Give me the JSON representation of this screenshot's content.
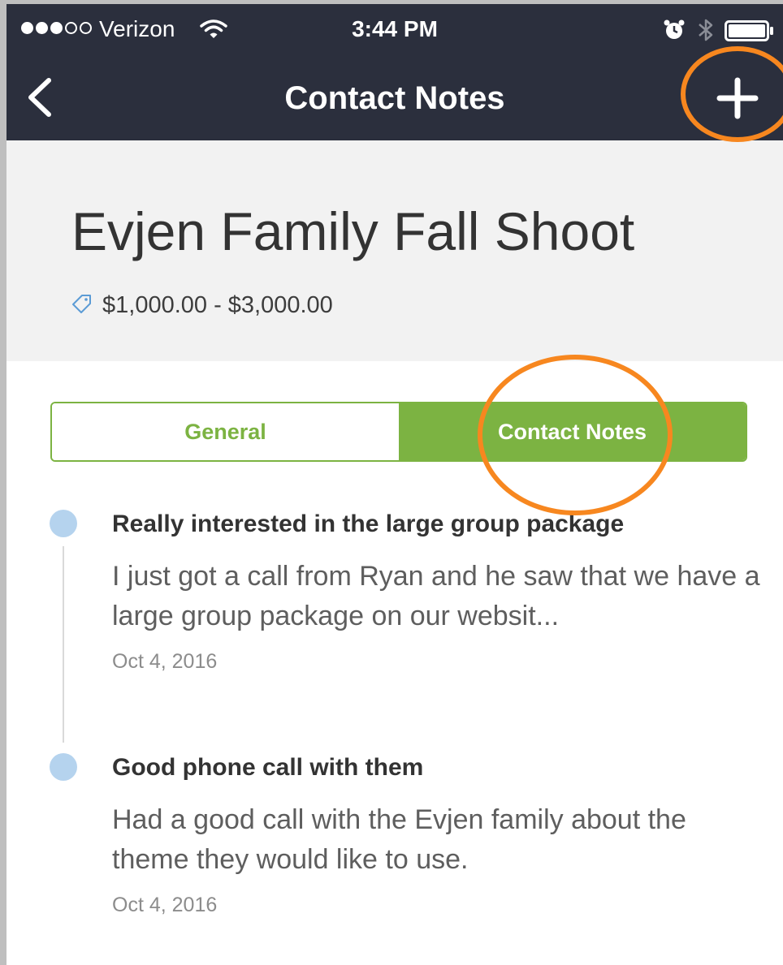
{
  "status_bar": {
    "carrier": "Verizon",
    "signal_bars_filled": 3,
    "signal_bars_total": 5,
    "time": "3:44 PM",
    "icons": [
      "wifi-icon",
      "alarm-icon",
      "bluetooth-icon",
      "battery-icon"
    ]
  },
  "nav": {
    "title": "Contact Notes",
    "back_icon": "chevron-left-icon",
    "add_icon": "plus-icon"
  },
  "project": {
    "title": "Evjen Family Fall Shoot",
    "price_icon": "tag-icon",
    "price_range": "$1,000.00 - $3,000.00"
  },
  "tabs": [
    {
      "label": "General",
      "active": false
    },
    {
      "label": "Contact Notes",
      "active": true
    }
  ],
  "notes": [
    {
      "title": "Really interested in the large group package",
      "body": "I just got a call from Ryan and he saw that we have a large group package on our websit...",
      "date": "Oct 4, 2016"
    },
    {
      "title": "Good phone call with them",
      "body": "Had a good call with the Evjen family about the theme they would like to use.",
      "date": "Oct 4, 2016"
    }
  ],
  "colors": {
    "nav_background": "#2b2f3d",
    "accent_green": "#7cb342",
    "annotation_orange": "#f7871f",
    "timeline_dot": "#b5d3ee",
    "header_background": "#f2f2f2"
  }
}
